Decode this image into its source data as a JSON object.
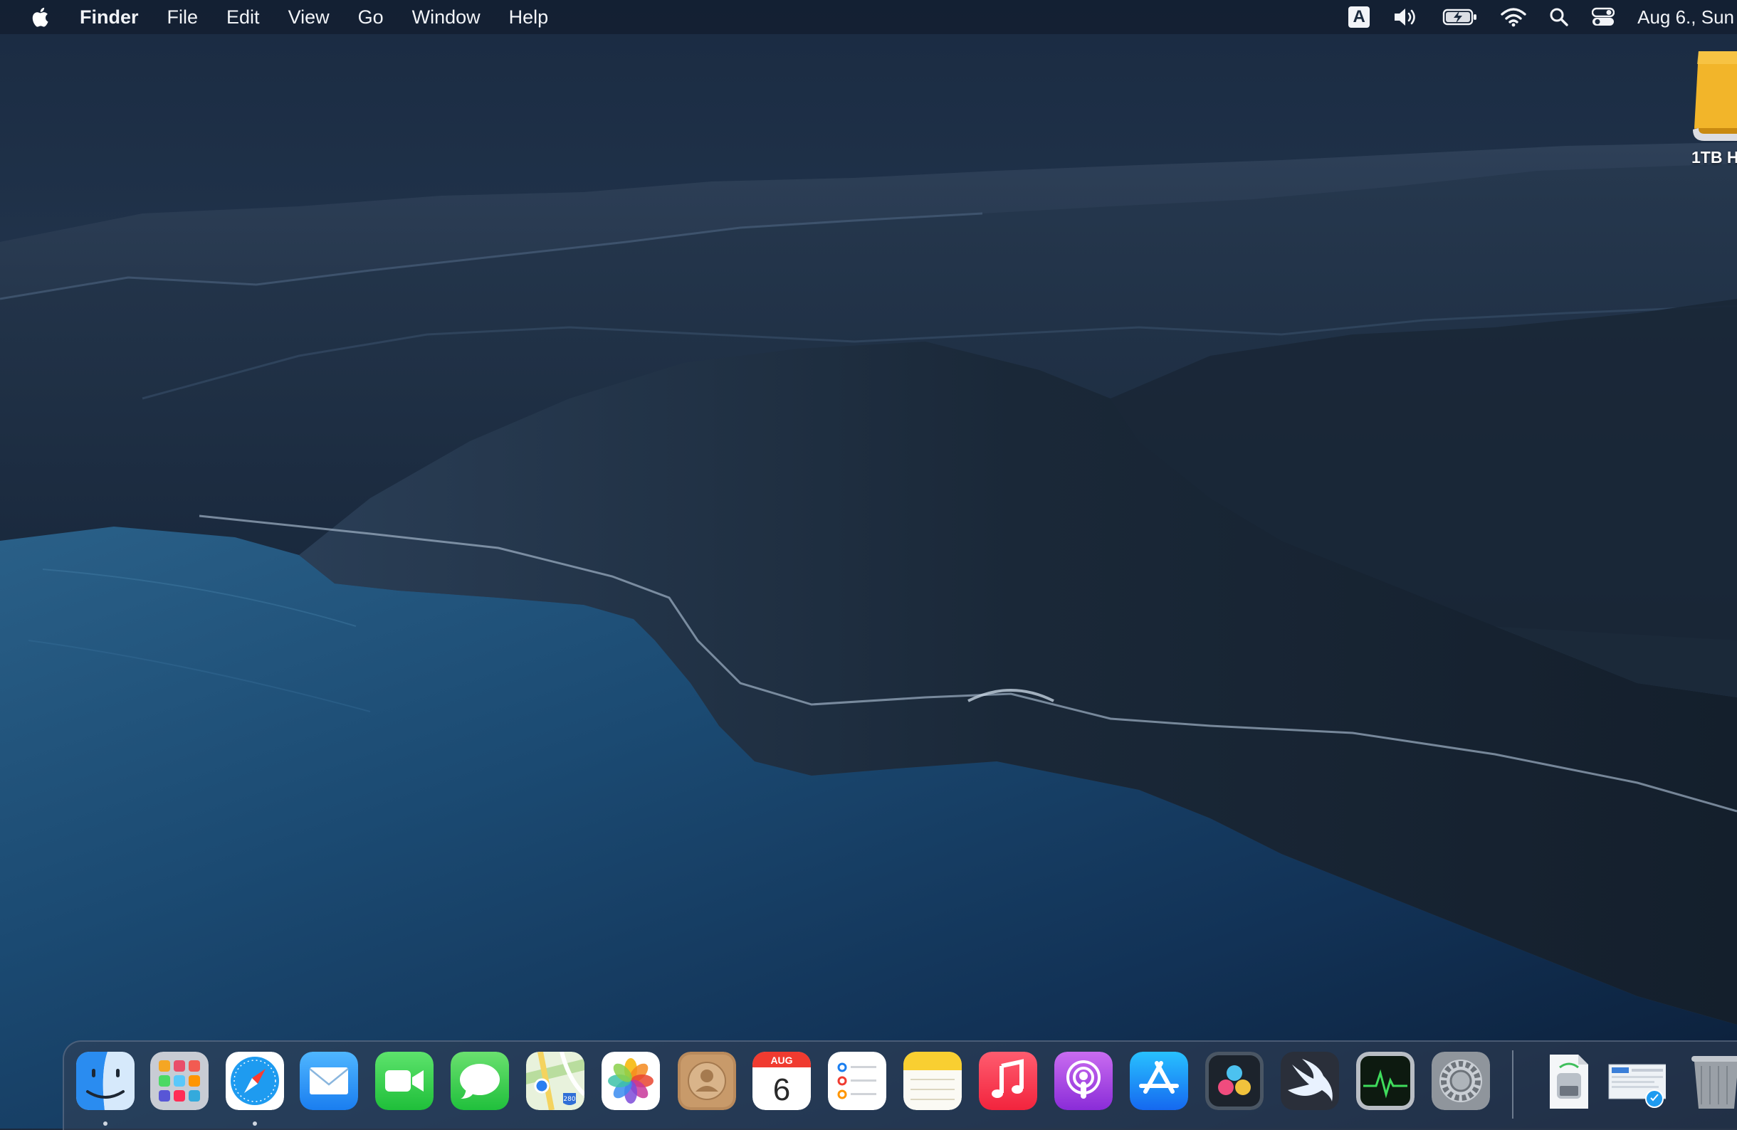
{
  "menubar": {
    "app_name": "Finder",
    "menus": [
      "File",
      "Edit",
      "View",
      "Go",
      "Window",
      "Help"
    ],
    "input_source": "A",
    "clock": "Aug 6., Sun"
  },
  "desktop": {
    "drive_label": "1TB H"
  },
  "dock": {
    "apps": [
      {
        "name": "Finder",
        "icon": "finder-icon",
        "running": true
      },
      {
        "name": "Launchpad",
        "icon": "launchpad-icon",
        "running": false
      },
      {
        "name": "Safari",
        "icon": "safari-icon",
        "running": true
      },
      {
        "name": "Mail",
        "icon": "mail-icon",
        "running": false
      },
      {
        "name": "FaceTime",
        "icon": "facetime-icon",
        "running": false
      },
      {
        "name": "Messages",
        "icon": "messages-icon",
        "running": false
      },
      {
        "name": "Maps",
        "icon": "maps-icon",
        "running": false
      },
      {
        "name": "Photos",
        "icon": "photos-icon",
        "running": false
      },
      {
        "name": "Contacts",
        "icon": "contacts-icon",
        "running": false
      },
      {
        "name": "Calendar",
        "icon": "calendar-icon",
        "running": false
      },
      {
        "name": "Reminders",
        "icon": "reminders-icon",
        "running": false
      },
      {
        "name": "Notes",
        "icon": "notes-icon",
        "running": false
      },
      {
        "name": "Music",
        "icon": "music-icon",
        "running": false
      },
      {
        "name": "Podcasts",
        "icon": "podcasts-icon",
        "running": false
      },
      {
        "name": "App Store",
        "icon": "app-store-icon",
        "running": false
      },
      {
        "name": "DaVinci Resolve",
        "icon": "davinci-resolve-icon",
        "running": false
      },
      {
        "name": "Swift Playgrounds",
        "icon": "swift-icon",
        "running": false
      },
      {
        "name": "Activity Monitor",
        "icon": "activity-monitor-icon",
        "running": false
      },
      {
        "name": "System Preferences",
        "icon": "system-preferences-icon",
        "running": false
      }
    ],
    "calendar": {
      "month": "AUG",
      "day": "6"
    },
    "maps_badge": "280",
    "stack_items": [
      {
        "name": "Disk Utility Document",
        "icon": "document-icon"
      },
      {
        "name": "Screenshot",
        "icon": "screenshot-icon"
      },
      {
        "name": "Trash",
        "icon": "trash-icon"
      }
    ]
  },
  "colors": {
    "menubar_bg": "#121e30",
    "water": "#1a3a5c",
    "mountains": "#1c2a3a",
    "drive": "#e8a21a"
  }
}
